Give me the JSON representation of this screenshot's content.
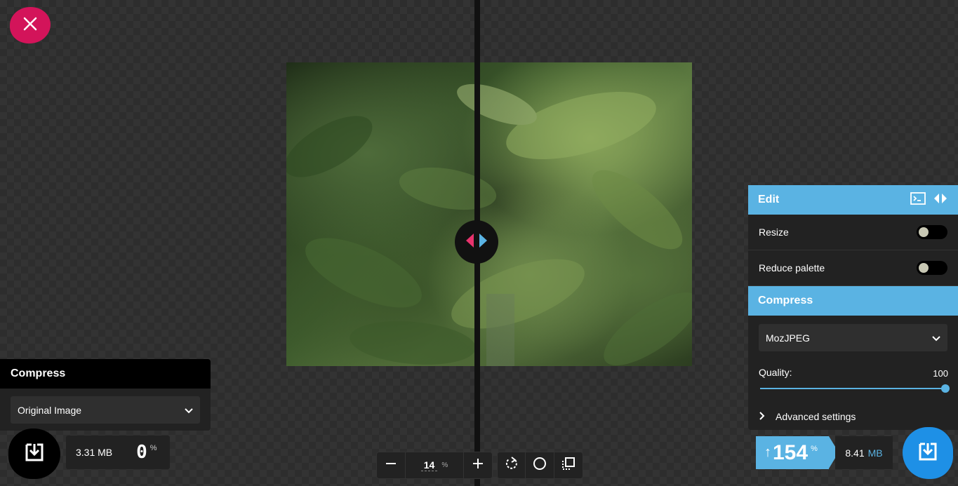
{
  "colors": {
    "close_button": "#d3145a",
    "accent_blue": "#5ab3e3",
    "download_right": "#1e90e6"
  },
  "left_panel": {
    "header": "Compress",
    "method_value": "Original Image",
    "size": "3.31 MB",
    "percent": "0",
    "percent_unit": "%"
  },
  "zoom": {
    "value": "14",
    "unit": "%"
  },
  "right_panel": {
    "edit_header": "Edit",
    "resize_label": "Resize",
    "resize_enabled": false,
    "reduce_palette_label": "Reduce palette",
    "reduce_palette_enabled": false,
    "compress_header": "Compress",
    "method_value": "MozJPEG",
    "quality_label": "Quality:",
    "quality_value": "100",
    "advanced_label": "Advanced settings"
  },
  "result": {
    "percent_arrow": "↑",
    "percent": "154",
    "percent_unit": "%",
    "size_number": "8.41",
    "size_unit": "MB"
  },
  "icons": {
    "close": "close-icon",
    "download": "download-icon",
    "rotate": "rotate-icon",
    "circle": "background-toggle-icon",
    "crop": "crop-icon",
    "terminal": "terminal-icon",
    "split": "split-view-icon"
  }
}
